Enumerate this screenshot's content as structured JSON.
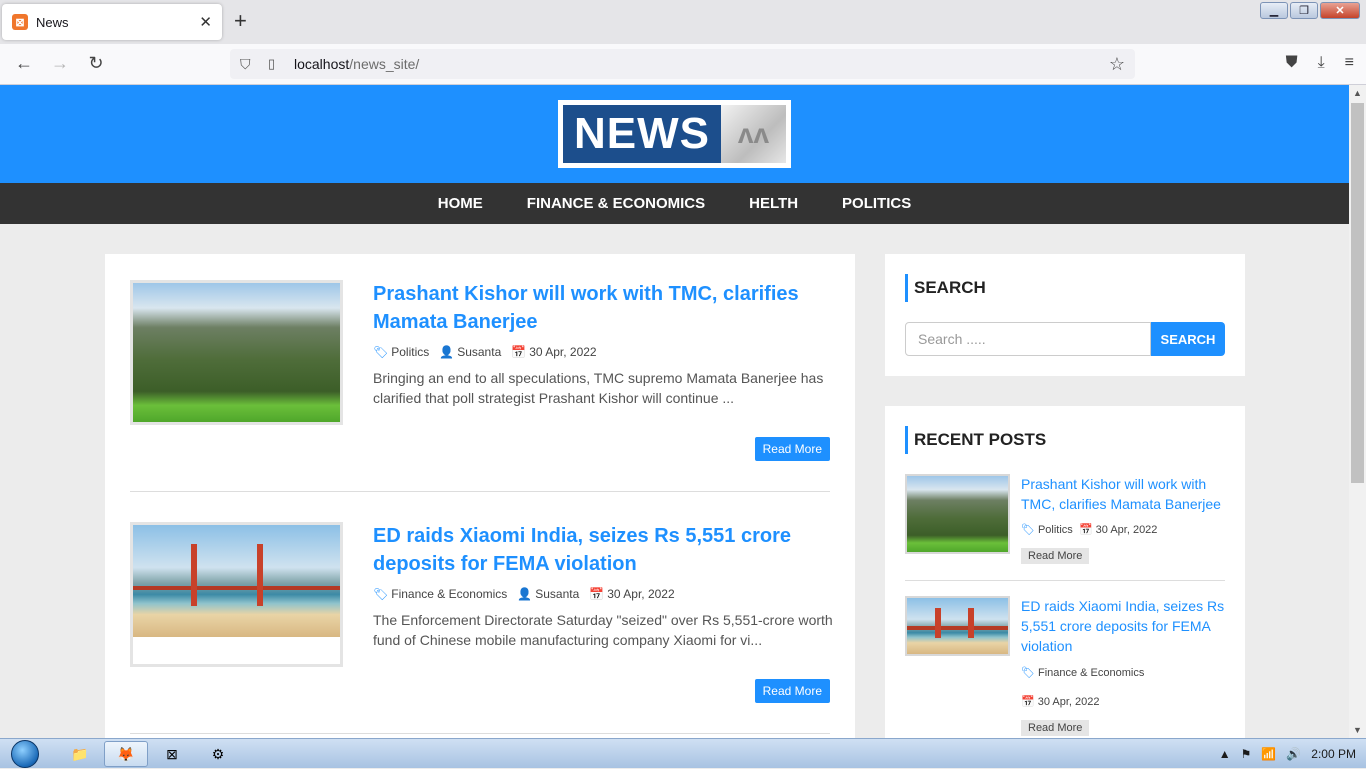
{
  "browser": {
    "tab_title": "News",
    "new_tab": "+",
    "url_host": "localhost",
    "url_path": "/news_site/",
    "window_controls": {
      "minimize": "▁",
      "restore": "❐",
      "close": "✕"
    }
  },
  "site": {
    "logo_text": "NEWS",
    "logo_mark": "ʌʌ",
    "menu": [
      "HOME",
      "FINANCE & ECONOMICS",
      "HELTH",
      "POLITICS"
    ]
  },
  "posts": [
    {
      "title": "Prashant Kishor will work with TMC, clarifies Mamata Banerjee",
      "category": "Politics",
      "author": "Susanta",
      "date": "30 Apr, 2022",
      "excerpt": "Bringing an end to all speculations, TMC supremo Mamata Banerjee has clarified that poll strategist Prashant Kishor will continue ...",
      "read_more": "Read More",
      "image": "mountain-landscape"
    },
    {
      "title": "ED raids Xiaomi India, seizes Rs 5,551 crore deposits for FEMA violation",
      "category": "Finance & Economics",
      "author": "Susanta",
      "date": "30 Apr, 2022",
      "excerpt": "The Enforcement Directorate Saturday \"seized\" over Rs 5,551-crore worth fund of Chinese mobile manufacturing company Xiaomi for vi...",
      "read_more": "Read More",
      "image": "golden-gate-bridge"
    }
  ],
  "sidebar": {
    "search_heading": "SEARCH",
    "search_placeholder": "Search .....",
    "search_button": "SEARCH",
    "recent_heading": "RECENT POSTS",
    "recent_posts": [
      {
        "title": "Prashant Kishor will work with TMC, clarifies Mamata Banerjee",
        "category": "Politics",
        "date": "30 Apr, 2022",
        "read_more": "Read More"
      },
      {
        "title": "ED raids Xiaomi India, seizes Rs 5,551 crore deposits for FEMA violation",
        "category": "Finance & Economics",
        "date": "30 Apr, 2022",
        "read_more": "Read More"
      }
    ]
  },
  "taskbar": {
    "clock": "2:00 PM"
  },
  "colors": {
    "accent": "#1e90ff",
    "menu_bg": "#333333",
    "header_bg": "#1e90ff"
  }
}
